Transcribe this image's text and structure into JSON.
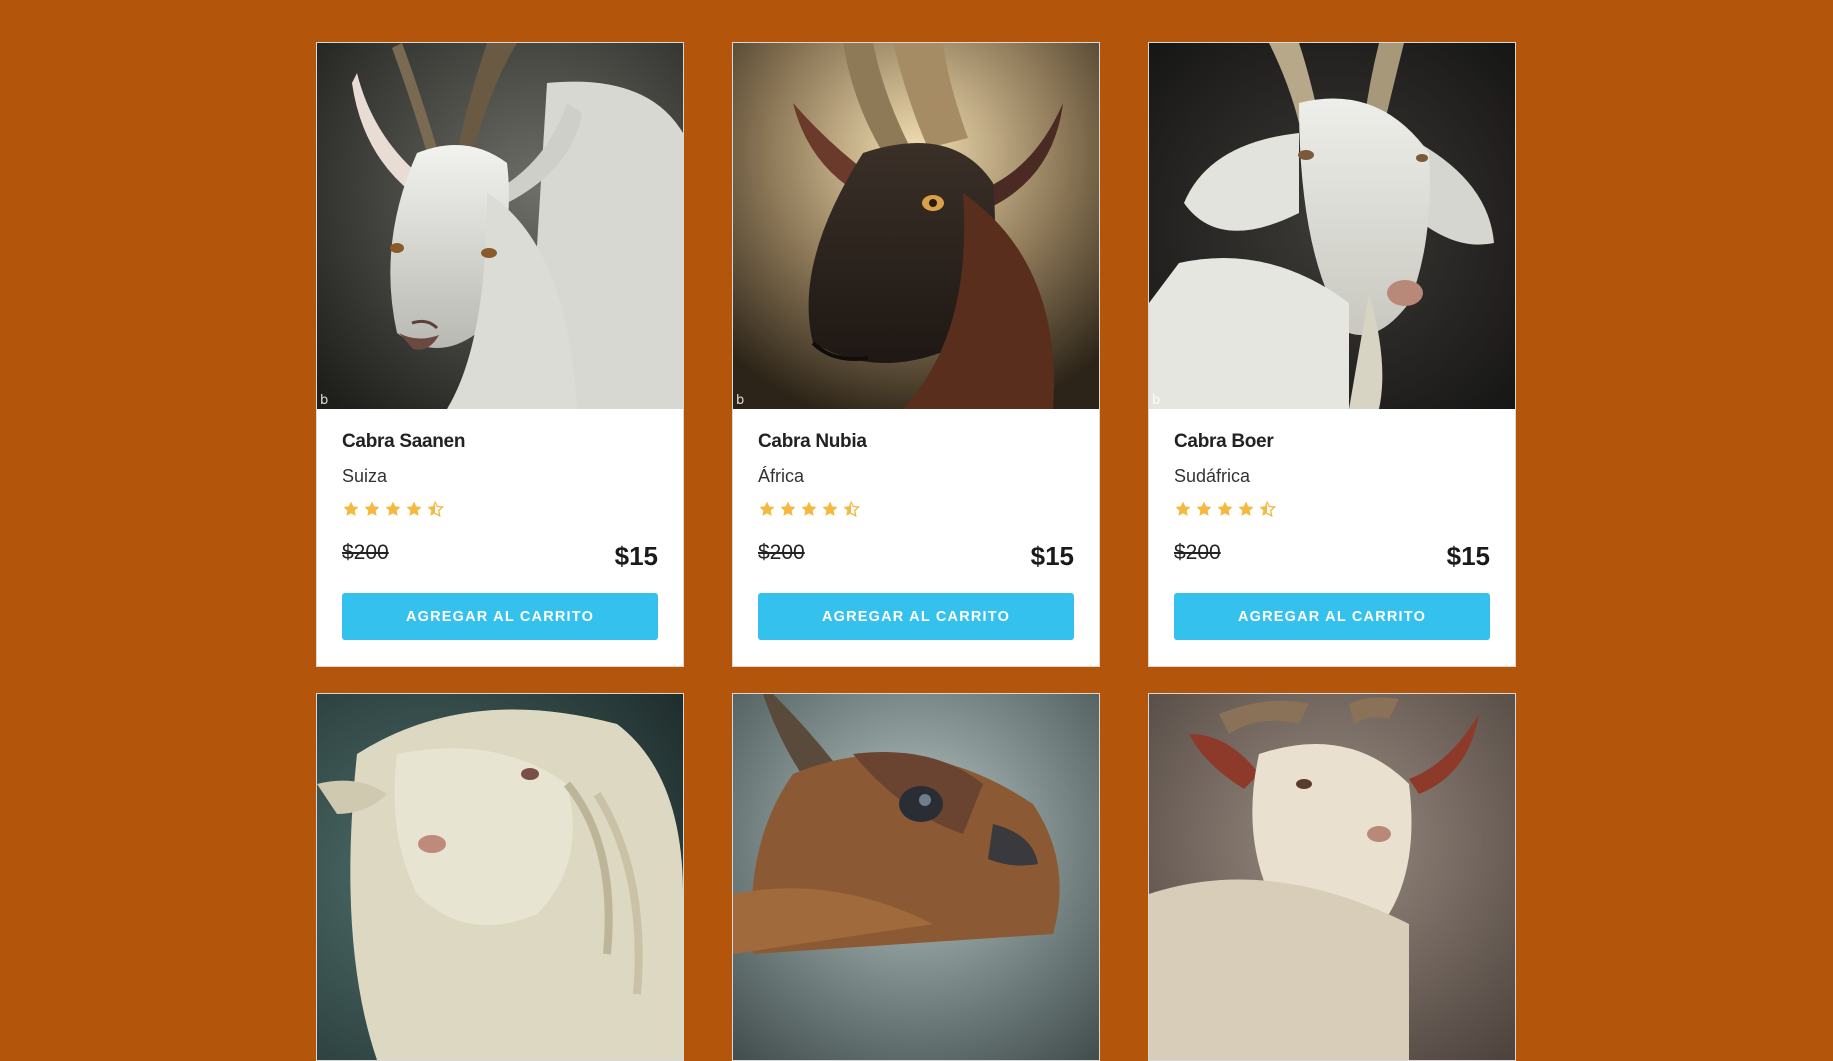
{
  "products": [
    {
      "name": "Cabra Saanen",
      "origin": "Suiza",
      "rating": 4.5,
      "old_price": "$200",
      "price": "$15",
      "button": "AGREGAR AL CARRITO",
      "image_icon": "goat-image",
      "watermark": "b"
    },
    {
      "name": "Cabra Nubia",
      "origin": "África",
      "rating": 4.5,
      "old_price": "$200",
      "price": "$15",
      "button": "AGREGAR AL CARRITO",
      "image_icon": "goat-image",
      "watermark": "b"
    },
    {
      "name": "Cabra Boer",
      "origin": "Sudáfrica",
      "rating": 4.5,
      "old_price": "$200",
      "price": "$15",
      "button": "AGREGAR AL CARRITO",
      "image_icon": "goat-image",
      "watermark": "b"
    },
    {
      "image_icon": "goat-image"
    },
    {
      "image_icon": "goat-image"
    },
    {
      "image_icon": "goat-image"
    }
  ],
  "colors": {
    "background": "#b3560b",
    "button": "#35c1ee",
    "star": "#f5b942"
  }
}
